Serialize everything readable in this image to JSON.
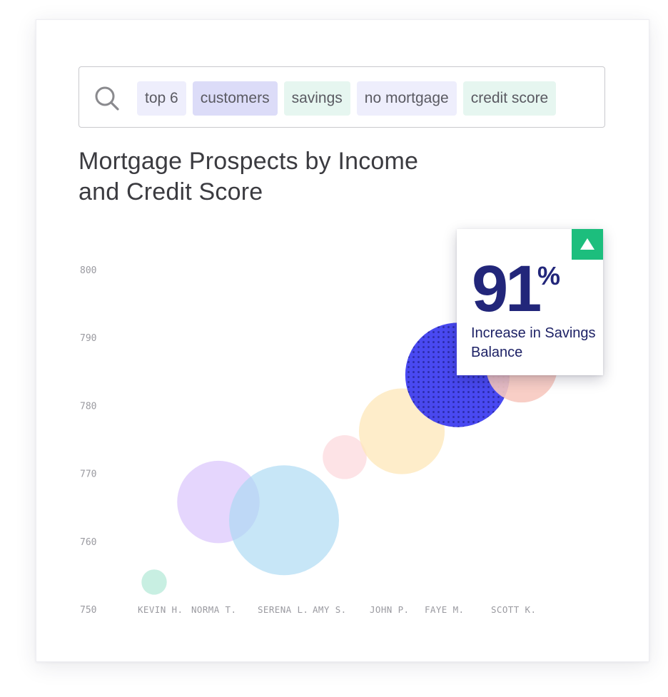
{
  "search": {
    "icon": "search-icon",
    "chips": [
      {
        "label": "top 6",
        "color": "#eeeefc"
      },
      {
        "label": "customers",
        "color": "#dcdcf8"
      },
      {
        "label": "savings",
        "color": "#e6f6f0"
      },
      {
        "label": "no mortgage",
        "color": "#eeeefc"
      },
      {
        "label": "credit score",
        "color": "#e6f6f0"
      }
    ]
  },
  "title_line1": "Mortgage Prospects by Income",
  "title_line2": "and Credit Score",
  "callout": {
    "value": "91",
    "unit": "%",
    "caption": "Increase in Savings Balance",
    "badge_icon": "triangle-up-icon",
    "badge_color": "#1cbe7d",
    "text_color": "#22267a"
  },
  "chart_data": {
    "type": "scatter",
    "subtype": "bubble",
    "title": "Mortgage Prospects by Income and Credit Score",
    "xlabel": "",
    "ylabel": "",
    "ylim": [
      750,
      800
    ],
    "yticks": [
      800,
      790,
      780,
      770,
      760,
      750
    ],
    "grid": false,
    "categories": [
      "KEVIN H.",
      "NORMA T.",
      "SERENA L.",
      "AMY S.",
      "JOHN P.",
      "FAYE M.",
      "SCOTT K."
    ],
    "points": [
      {
        "name": "KEVIN H.",
        "credit_score": 754.0,
        "relative_size": 0.23,
        "color": "#c8efe2",
        "opacity": 1.0,
        "pattern": "none"
      },
      {
        "name": "NORMA T.",
        "credit_score": 765.8,
        "relative_size": 0.75,
        "color": "#dcc8fc",
        "opacity": 0.75,
        "pattern": "none"
      },
      {
        "name": "SERENA L.",
        "credit_score": 763.1,
        "relative_size": 1.0,
        "color": "#a9d8f3",
        "opacity": 0.65,
        "pattern": "none"
      },
      {
        "name": "AMY S.",
        "credit_score": 772.4,
        "relative_size": 0.4,
        "color": "#fde3e6",
        "opacity": 1.0,
        "pattern": "none"
      },
      {
        "name": "JOHN P.",
        "credit_score": 776.2,
        "relative_size": 0.78,
        "color": "#fde7b8",
        "opacity": 0.75,
        "pattern": "none"
      },
      {
        "name": "FAYE M.",
        "credit_score": 784.5,
        "relative_size": 0.95,
        "color": "#3a3af0",
        "opacity": 0.92,
        "pattern": "dots",
        "highlighted": true
      },
      {
        "name": "SCOTT K.",
        "credit_score": 785.7,
        "relative_size": 0.65,
        "color": "#f7c9c0",
        "opacity": 0.9,
        "pattern": "none"
      }
    ]
  }
}
